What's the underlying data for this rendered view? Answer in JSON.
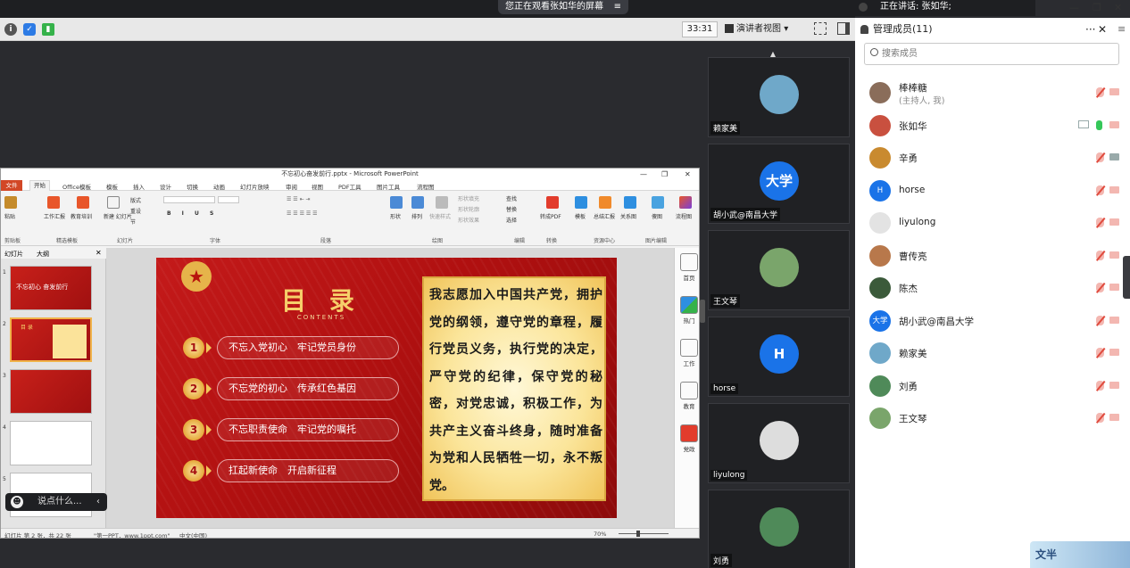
{
  "meeting": {
    "share_banner": "您正在观看张如华的屏幕",
    "share_menu_icon": "menu-icon",
    "speaking": "正在讲话: 张如华;",
    "timer": "33:31",
    "view_mode": "演讲者视图",
    "view_arrow": "▾",
    "chat_placeholder": "说点什么...",
    "chat_chevron": "‹"
  },
  "ppt": {
    "window_title": "不忘初心奋发前行.pptx - Microsoft PowerPoint",
    "tabs": [
      "文件",
      "开始",
      "Office模板",
      "模板",
      "插入",
      "设计",
      "切换",
      "动画",
      "幻灯片放映",
      "审阅",
      "视图",
      "PDF工具",
      "图片工具",
      "流程图"
    ],
    "ribbon_groups": [
      "剪贴板",
      "精选模板",
      "幻灯片",
      "字体",
      "段落",
      "绘图",
      "编辑",
      "转换",
      "资源中心",
      "图片编辑"
    ],
    "ribbon_buttons": {
      "paste": "粘贴",
      "work_report": "工作汇报",
      "edu": "教育培训",
      "new_slide": "新建\n幻灯片",
      "layout": "版式",
      "reset": "重设",
      "section": "节",
      "shape": "形状",
      "arrange": "排列",
      "quick_style": "快速样式",
      "shape_fill": "形状填充",
      "shape_outline": "形状轮廓",
      "shape_effect": "形状效果",
      "find": "查找",
      "replace": "替换",
      "select": "选择",
      "to_pdf": "转成PDF",
      "template": "模板",
      "summary": "总结汇报",
      "relation": "关系图",
      "image": "傻图",
      "flowchart": "流程图"
    },
    "panel_tabs": [
      "幻灯片",
      "大纲"
    ],
    "thumb_numbers": [
      "1",
      "2",
      "3",
      "4",
      "5"
    ],
    "thumb1_text": "不忘初心 奋发前行",
    "thumb2_text": "目 录",
    "slide": {
      "title": "目 录",
      "subtitle": "CONTENTS",
      "items": [
        {
          "num": "1",
          "text": "不忘入党初心　牢记党员身份"
        },
        {
          "num": "2",
          "text": "不忘党的初心　传承红色基因"
        },
        {
          "num": "3",
          "text": "不忘职责使命　牢记党的嘱托"
        },
        {
          "num": "4",
          "text": "扛起新使命　开启新征程"
        }
      ],
      "oath": "我志愿加入中国共产党，拥护党的纲领，遵守党的章程，履行党员义务，执行党的决定，严守党的纪律，保守党的秘密，对党忠诚，积极工作，为共产主义奋斗终身，随时准备为党和人民牺牲一切，永不叛党。"
    },
    "rail": [
      "首页",
      "热门",
      "工作",
      "教育",
      "党政"
    ],
    "status": {
      "slide_pos": "幻灯片 第 2 张，共 22 张",
      "theme": "\"第一PPT，www.1ppt.com\"",
      "lang": "中文(中国)",
      "zoom": "70%"
    }
  },
  "video_tiles": [
    {
      "name": "赖家美",
      "kind": "photo",
      "color": "#6fa8c9"
    },
    {
      "name": "胡小武@南昌大学",
      "kind": "text",
      "label": "大学"
    },
    {
      "name": "王文琴",
      "kind": "photo",
      "color": "#7aa56b"
    },
    {
      "name": "horse",
      "kind": "text",
      "label": "H"
    },
    {
      "name": "liyulong",
      "kind": "gray"
    },
    {
      "name": "刘勇",
      "kind": "photo",
      "color": "#4f8a59"
    }
  ],
  "members": {
    "title": "管理成员(11)",
    "more": "···",
    "close": "✕",
    "menu": "≡",
    "search_placeholder": "搜索成员",
    "list": [
      {
        "name": "棒棒糖",
        "sub": "(主持人, 我)",
        "avatar": "photo",
        "color": "#8a6d5a",
        "mic": "off",
        "cam": "off"
      },
      {
        "name": "张如华",
        "sub": "",
        "avatar": "photo",
        "color": "#c9503f",
        "mic": "on",
        "cam": "off",
        "screen": true
      },
      {
        "name": "辛勇",
        "sub": "",
        "avatar": "photo",
        "color": "#c98a2f",
        "mic": "off",
        "cam": "gray"
      },
      {
        "name": "horse",
        "sub": "",
        "avatar": "text",
        "label": "H",
        "mic": "off",
        "cam": "off"
      },
      {
        "name": "liyulong",
        "sub": "",
        "avatar": "gray",
        "mic": "off",
        "cam": "off"
      },
      {
        "name": "曹传亮",
        "sub": "",
        "avatar": "photo",
        "color": "#b8784b",
        "mic": "off",
        "cam": "off"
      },
      {
        "name": "陈杰",
        "sub": "",
        "avatar": "photo",
        "color": "#3b5a3a",
        "mic": "off",
        "cam": "off"
      },
      {
        "name": "胡小武@南昌大学",
        "sub": "",
        "avatar": "text",
        "label": "大学",
        "mic": "off",
        "cam": "off"
      },
      {
        "name": "赖家美",
        "sub": "",
        "avatar": "photo",
        "color": "#6fa8c9",
        "mic": "off",
        "cam": "off"
      },
      {
        "name": "刘勇",
        "sub": "",
        "avatar": "photo",
        "color": "#4f8a59",
        "mic": "off",
        "cam": "off"
      },
      {
        "name": "王文琴",
        "sub": "",
        "avatar": "photo",
        "color": "#7aa56b",
        "mic": "off",
        "cam": "off"
      }
    ]
  },
  "window": {
    "minimize": "—",
    "restore": "❐",
    "close": "✕"
  },
  "promo_text": "文半"
}
